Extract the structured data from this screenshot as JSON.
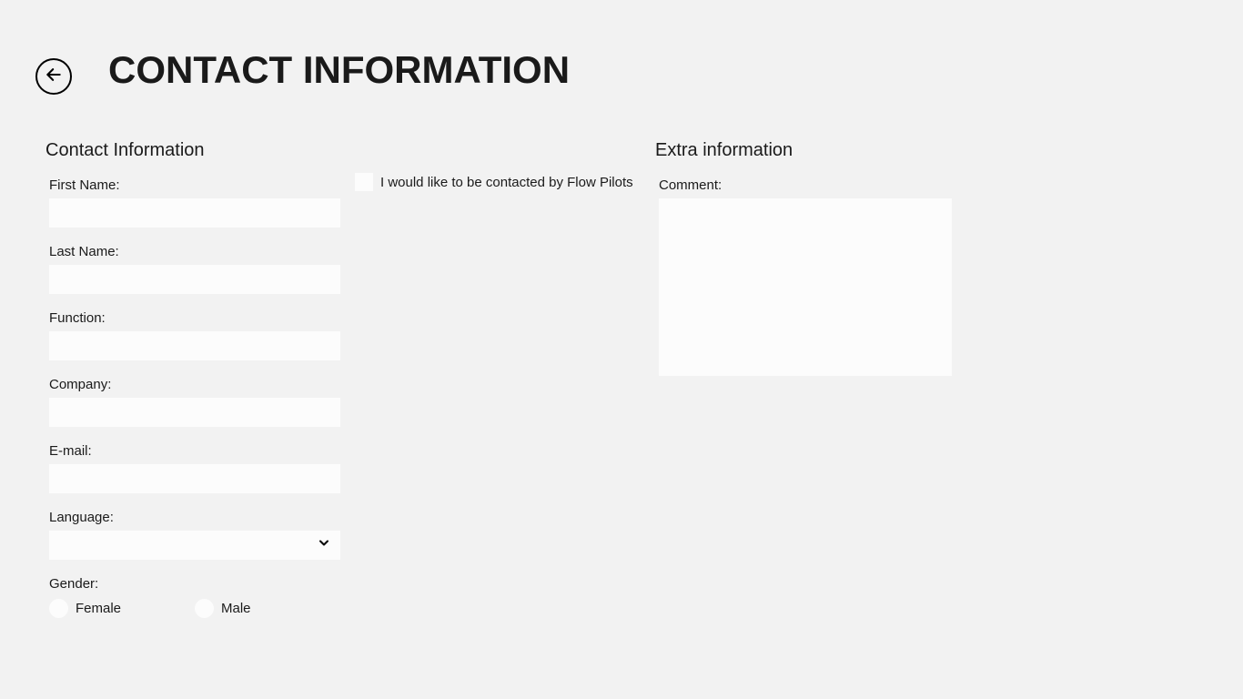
{
  "header": {
    "title": "CONTACT INFORMATION"
  },
  "sections": {
    "contact": {
      "title": "Contact Information",
      "fields": {
        "firstName": {
          "label": "First Name:",
          "value": ""
        },
        "lastName": {
          "label": "Last Name:",
          "value": ""
        },
        "function": {
          "label": "Function:",
          "value": ""
        },
        "company": {
          "label": "Company:",
          "value": ""
        },
        "email": {
          "label": "E-mail:",
          "value": ""
        },
        "language": {
          "label": "Language:",
          "value": ""
        },
        "gender": {
          "label": "Gender:",
          "options": {
            "female": "Female",
            "male": "Male"
          }
        }
      },
      "consent": {
        "label": "I would like to be contacted by Flow Pilots",
        "checked": false
      }
    },
    "extra": {
      "title": "Extra information",
      "comment": {
        "label": "Comment:",
        "value": ""
      }
    }
  }
}
